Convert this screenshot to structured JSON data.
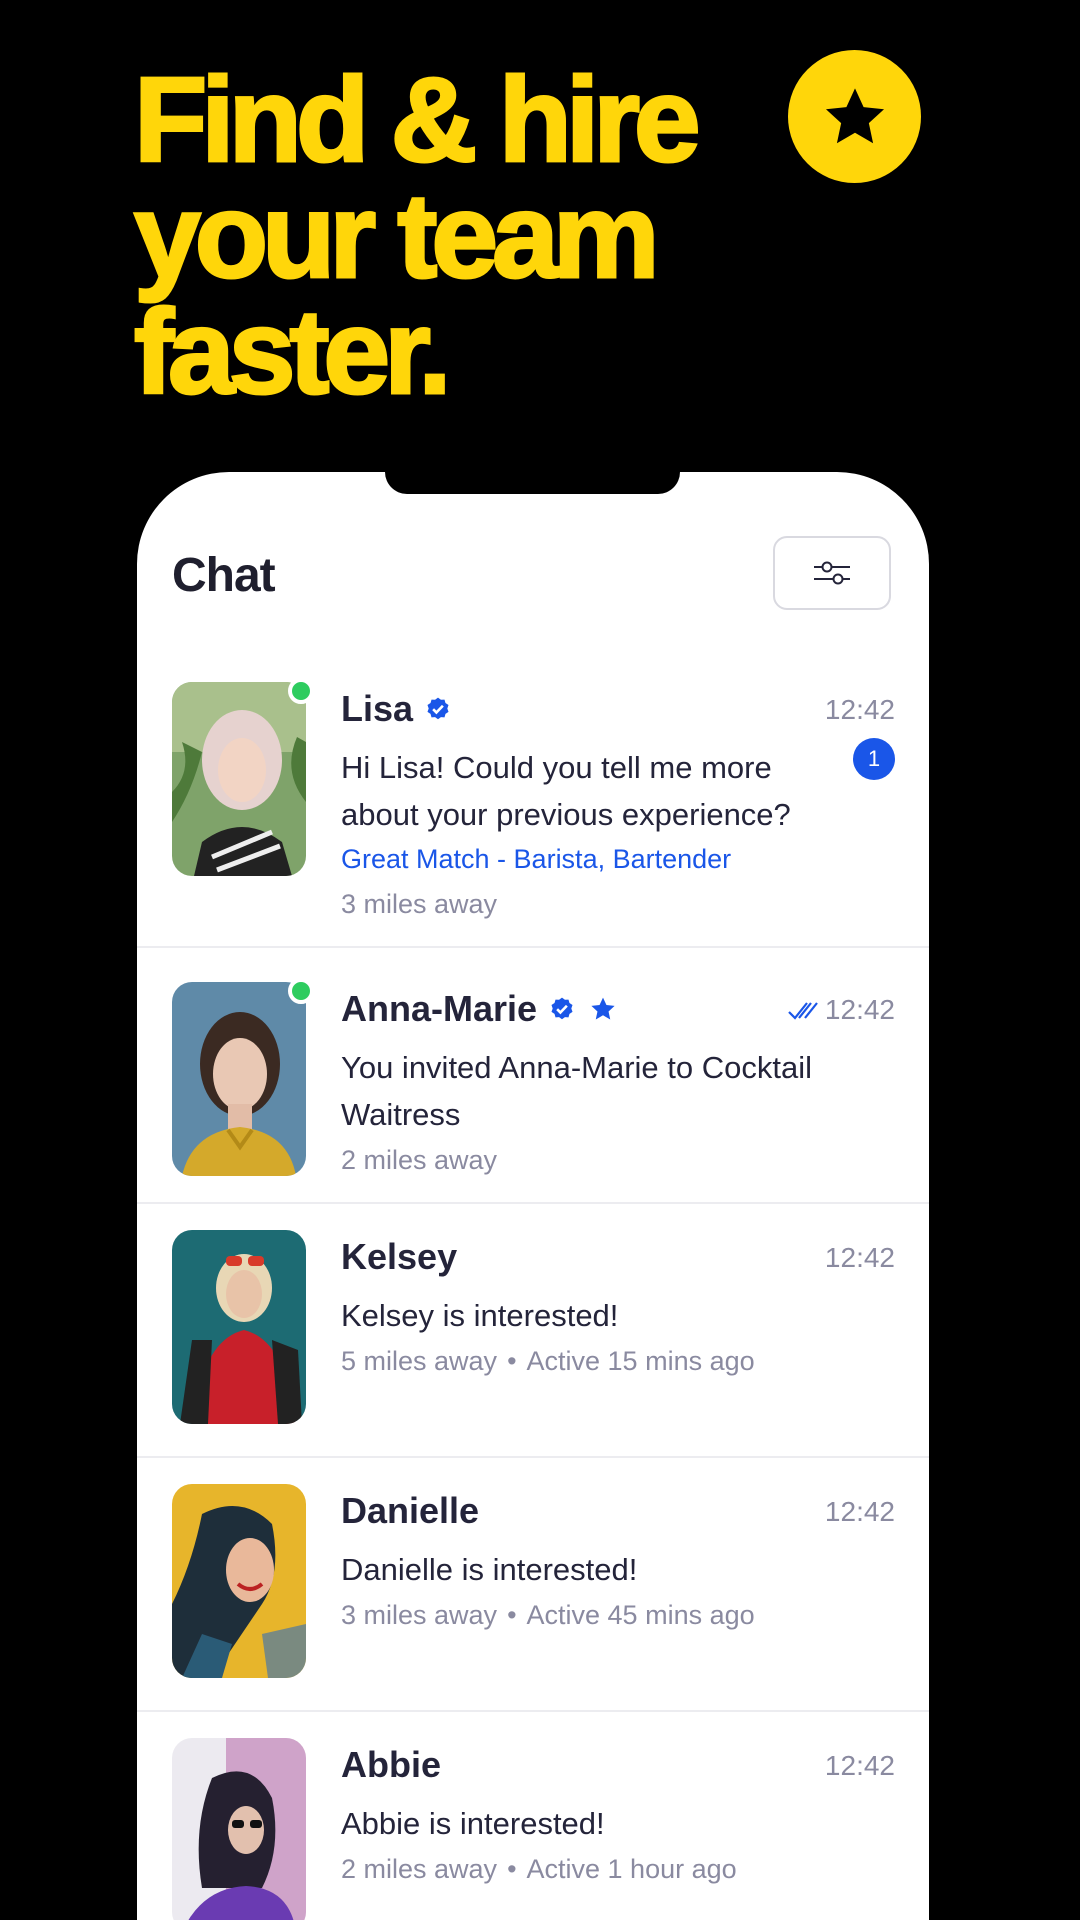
{
  "headline": [
    "Find & hire",
    "your team",
    "faster."
  ],
  "colors": {
    "brand_yellow": "#FFD60A",
    "accent_blue": "#1A56E8",
    "online_green": "#2ECC5F",
    "background": "#000000"
  },
  "icons": {
    "badge": "star-icon",
    "filter": "sliders-icon",
    "verified": "verified-badge-icon",
    "favorite": "star-icon",
    "read_receipt": "double-check-icon"
  },
  "screen": {
    "title": "Chat",
    "conversations": [
      {
        "name": "Lisa",
        "verified": true,
        "favorite": false,
        "online": true,
        "time": "12:42",
        "read": false,
        "message": "Hi Lisa! Could you tell me more about your previous experience?",
        "match": "Great Match - Barista, Bartender",
        "distance": "3 miles away",
        "activity": "",
        "unread": "1"
      },
      {
        "name": "Anna-Marie",
        "verified": true,
        "favorite": true,
        "online": true,
        "time": "12:42",
        "read": true,
        "message": "You invited Anna-Marie to Cocktail Waitress",
        "match": "",
        "distance": "2 miles away",
        "activity": "",
        "unread": ""
      },
      {
        "name": "Kelsey",
        "verified": false,
        "favorite": false,
        "online": false,
        "time": "12:42",
        "read": false,
        "message": "Kelsey is interested!",
        "match": "",
        "distance": "5 miles away",
        "activity": "Active 15 mins ago",
        "unread": ""
      },
      {
        "name": "Danielle",
        "verified": false,
        "favorite": false,
        "online": false,
        "time": "12:42",
        "read": false,
        "message": "Danielle is interested!",
        "match": "",
        "distance": "3 miles away",
        "activity": "Active 45 mins ago",
        "unread": ""
      },
      {
        "name": "Abbie",
        "verified": false,
        "favorite": false,
        "online": false,
        "time": "12:42",
        "read": false,
        "message": "Abbie is interested!",
        "match": "",
        "distance": "2 miles away",
        "activity": "Active 1 hour ago",
        "unread": ""
      }
    ]
  }
}
